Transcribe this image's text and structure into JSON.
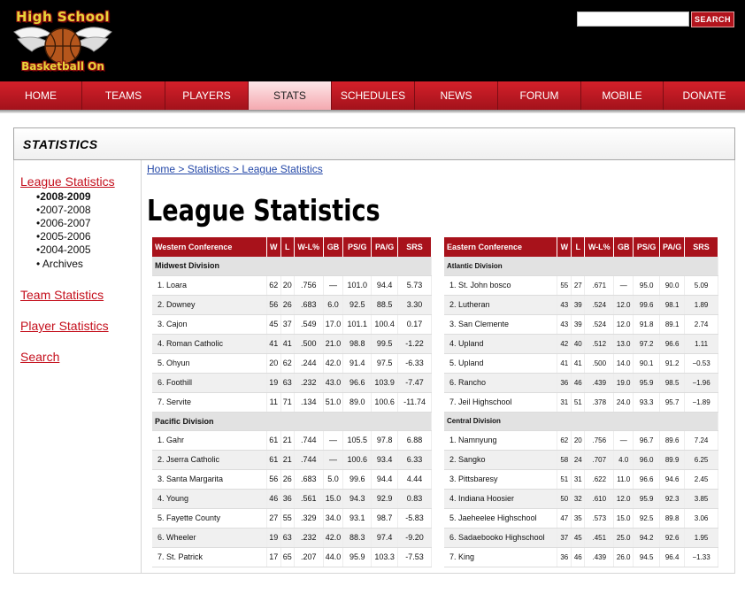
{
  "site": {
    "logo_top": "High School",
    "logo_bottom": "Basketball On",
    "search_placeholder": "",
    "search_button": "SEARCH"
  },
  "nav": [
    {
      "label": "HOME",
      "name": "nav-home"
    },
    {
      "label": "TEAMS",
      "name": "nav-teams"
    },
    {
      "label": "PLAYERS",
      "name": "nav-players"
    },
    {
      "label": "STATS",
      "name": "nav-stats",
      "active": true
    },
    {
      "label": "SCHEDULES",
      "name": "nav-schedules"
    },
    {
      "label": "NEWS",
      "name": "nav-news"
    },
    {
      "label": "FORUM",
      "name": "nav-forum"
    },
    {
      "label": "MOBILE",
      "name": "nav-mobile"
    },
    {
      "label": "DONATE",
      "name": "nav-donate"
    }
  ],
  "section_title": "STATISTICS",
  "sidebar": {
    "league_statistics": "League Statistics",
    "years": [
      "•2008-2009",
      "•2007-2008",
      "•2006-2007",
      "•2005-2006",
      "•2004-2005",
      "• Archives"
    ],
    "team_statistics": "Team Statistics",
    "player_statistics": "Player Statistics",
    "search": "Search"
  },
  "breadcrumb": {
    "home": "Home",
    "sep1": " > ",
    "statistics": "Statistics",
    "sep2": " > ",
    "current": "League Statistics"
  },
  "page_title": "League Statistics",
  "west": {
    "headers": [
      "Western Conference",
      "W",
      "L",
      "W-L%",
      "GB",
      "PS/G",
      "PA/G",
      "SRS"
    ],
    "divisions": [
      {
        "name": "Midwest Division",
        "rows": [
          [
            "1.  Loara",
            "62",
            "20",
            ".756",
            "—",
            "101.0",
            "94.4",
            "5.73"
          ],
          [
            "2. Downey",
            "56",
            "26",
            ".683",
            "6.0",
            "92.5",
            "88.5",
            "3.30"
          ],
          [
            "3. Cajon",
            "45",
            "37",
            ".549",
            "17.0",
            "101.1",
            "100.4",
            "0.17"
          ],
          [
            "4. Roman  Catholic",
            "41",
            "41",
            ".500",
            "21.0",
            "98.8",
            "99.5",
            "-1.22"
          ],
          [
            "5. Ohyun",
            "20",
            "62",
            ".244",
            "42.0",
            "91.4",
            "97.5",
            "-6.33"
          ],
          [
            "6. Foothill",
            "19",
            "63",
            ".232",
            "43.0",
            "96.6",
            "103.9",
            "-7.47"
          ],
          [
            "7. Servite",
            "11",
            "71",
            ".134",
            "51.0",
            "89.0",
            "100.6",
            "-11.74"
          ]
        ]
      },
      {
        "name": "Pacific Division",
        "rows": [
          [
            "1. Gahr",
            "61",
            "21",
            ".744",
            "—",
            "105.5",
            "97.8",
            "6.88"
          ],
          [
            "2. Jserra Catholic",
            "61",
            "21",
            ".744",
            "—",
            "100.6",
            "93.4",
            "6.33"
          ],
          [
            "3. Santa  Margarita",
            "56",
            "26",
            ".683",
            "5.0",
            "99.6",
            "94.4",
            "4.44"
          ],
          [
            "4. Young",
            "46",
            "36",
            ".561",
            "15.0",
            "94.3",
            "92.9",
            "0.83"
          ],
          [
            "5. Fayette County",
            "27",
            "55",
            ".329",
            "34.0",
            "93.1",
            "98.7",
            "-5.83"
          ],
          [
            "6. Wheeler",
            "19",
            "63",
            ".232",
            "42.0",
            "88.3",
            "97.4",
            "-9.20"
          ],
          [
            "7. St. Patrick",
            "17",
            "65",
            ".207",
            "44.0",
            "95.9",
            "103.3",
            "-7.53"
          ]
        ]
      }
    ]
  },
  "east": {
    "headers": [
      "Eastern Conference",
      "W",
      "L",
      "W-L%",
      "GB",
      "PS/G",
      "PA/G",
      "SRS"
    ],
    "divisions": [
      {
        "name": "Atlantic Division",
        "rows": [
          [
            "1. St. John bosco",
            "55",
            "27",
            ".671",
            "—",
            "95.0",
            "90.0",
            "5.09"
          ],
          [
            "2. Lutheran",
            "43",
            "39",
            ".524",
            "12.0",
            "99.6",
            "98.1",
            "1.89"
          ],
          [
            "3. San Clemente",
            "43",
            "39",
            ".524",
            "12.0",
            "91.8",
            "89.1",
            "2.74"
          ],
          [
            "4. Upland",
            "42",
            "40",
            ".512",
            "13.0",
            "97.2",
            "96.6",
            "1.11"
          ],
          [
            "5. Upland",
            "41",
            "41",
            ".500",
            "14.0",
            "90.1",
            "91.2",
            "−0.53"
          ],
          [
            "6. Rancho",
            "36",
            "46",
            ".439",
            "19.0",
            "95.9",
            "98.5",
            "−1.96"
          ],
          [
            "7. Jeil Highschool",
            "31",
            "51",
            ".378",
            "24.0",
            "93.3",
            "95.7",
            "−1.89"
          ]
        ]
      },
      {
        "name": "Central Division",
        "rows": [
          [
            "1. Namnyung",
            "62",
            "20",
            ".756",
            "—",
            "96.7",
            "89.6",
            "7.24"
          ],
          [
            "2. Sangko",
            "58",
            "24",
            ".707",
            "4.0",
            "96.0",
            "89.9",
            "6.25"
          ],
          [
            "3. Pittsbaresy",
            "51",
            "31",
            ".622",
            "11.0",
            "96.6",
            "94.6",
            "2.45"
          ],
          [
            "4. Indiana  Hoosier",
            "50",
            "32",
            ".610",
            "12.0",
            "95.9",
            "92.3",
            "3.85"
          ],
          [
            "5. Jaeheelee  Highschool",
            "47",
            "35",
            ".573",
            "15.0",
            "92.5",
            "89.8",
            "3.06"
          ],
          [
            "6. Sadaebooko  Highschool",
            "37",
            "45",
            ".451",
            "25.0",
            "94.2",
            "92.6",
            "1.95"
          ],
          [
            "7. King",
            "36",
            "46",
            ".439",
            "26.0",
            "94.5",
            "96.4",
            "−1.33"
          ]
        ]
      }
    ]
  }
}
